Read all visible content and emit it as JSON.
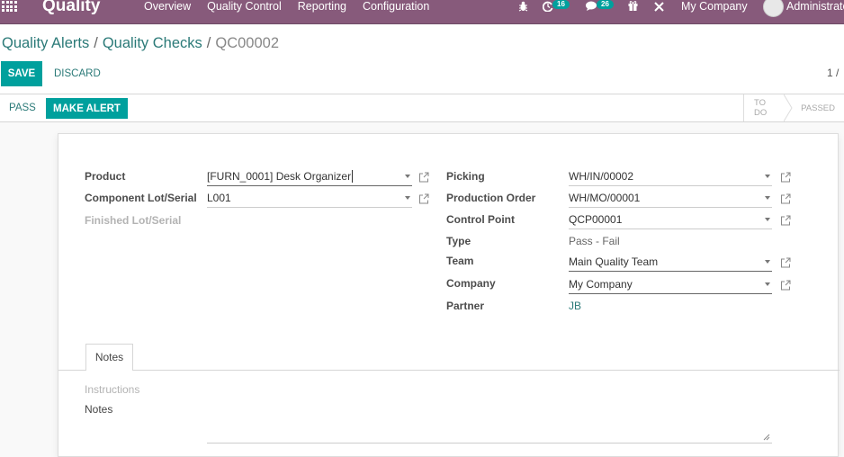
{
  "navbar": {
    "app_name": "Quality",
    "menu": [
      "Overview",
      "Quality Control",
      "Reporting",
      "Configuration"
    ],
    "icons": [
      "bug-icon",
      "activity-clock-icon",
      "messages-icon",
      "gift-icon",
      "tools-icon"
    ],
    "activity_count": "16",
    "message_count": "26",
    "company": "My Company",
    "user": "Administrator"
  },
  "breadcrumb": {
    "items": [
      "Quality Alerts",
      "Quality Checks"
    ],
    "current": "QC00002",
    "separator": "/"
  },
  "toolbar": {
    "save_label": "SAVE",
    "discard_label": "DISCARD",
    "pager": "1 /"
  },
  "statusbar": {
    "pass_label": "PASS",
    "make_alert_label": "MAKE ALERT",
    "stages": [
      "TO DO",
      "PASSED"
    ]
  },
  "form": {
    "left": {
      "product_label": "Product",
      "product_value": "[FURN_0001] Desk Organizer",
      "component_lot_label": "Component Lot/Serial",
      "component_lot_value": "L001",
      "finished_lot_label": "Finished Lot/Serial"
    },
    "right": {
      "picking_label": "Picking",
      "picking_value": "WH/IN/00002",
      "production_order_label": "Production Order",
      "production_order_value": "WH/MO/00001",
      "control_point_label": "Control Point",
      "control_point_value": "QCP00001",
      "type_label": "Type",
      "type_value": "Pass - Fail",
      "team_label": "Team",
      "team_value": "Main Quality Team",
      "company_label": "Company",
      "company_value": "My Company",
      "partner_label": "Partner",
      "partner_value": "JB"
    }
  },
  "notebook": {
    "tab_label": "Notes",
    "instructions_label": "Instructions",
    "notes_label": "Notes",
    "notes_value": ""
  },
  "colors": {
    "navbar": "#875a7b",
    "primary": "#00a09d",
    "link": "#2b7a78"
  }
}
